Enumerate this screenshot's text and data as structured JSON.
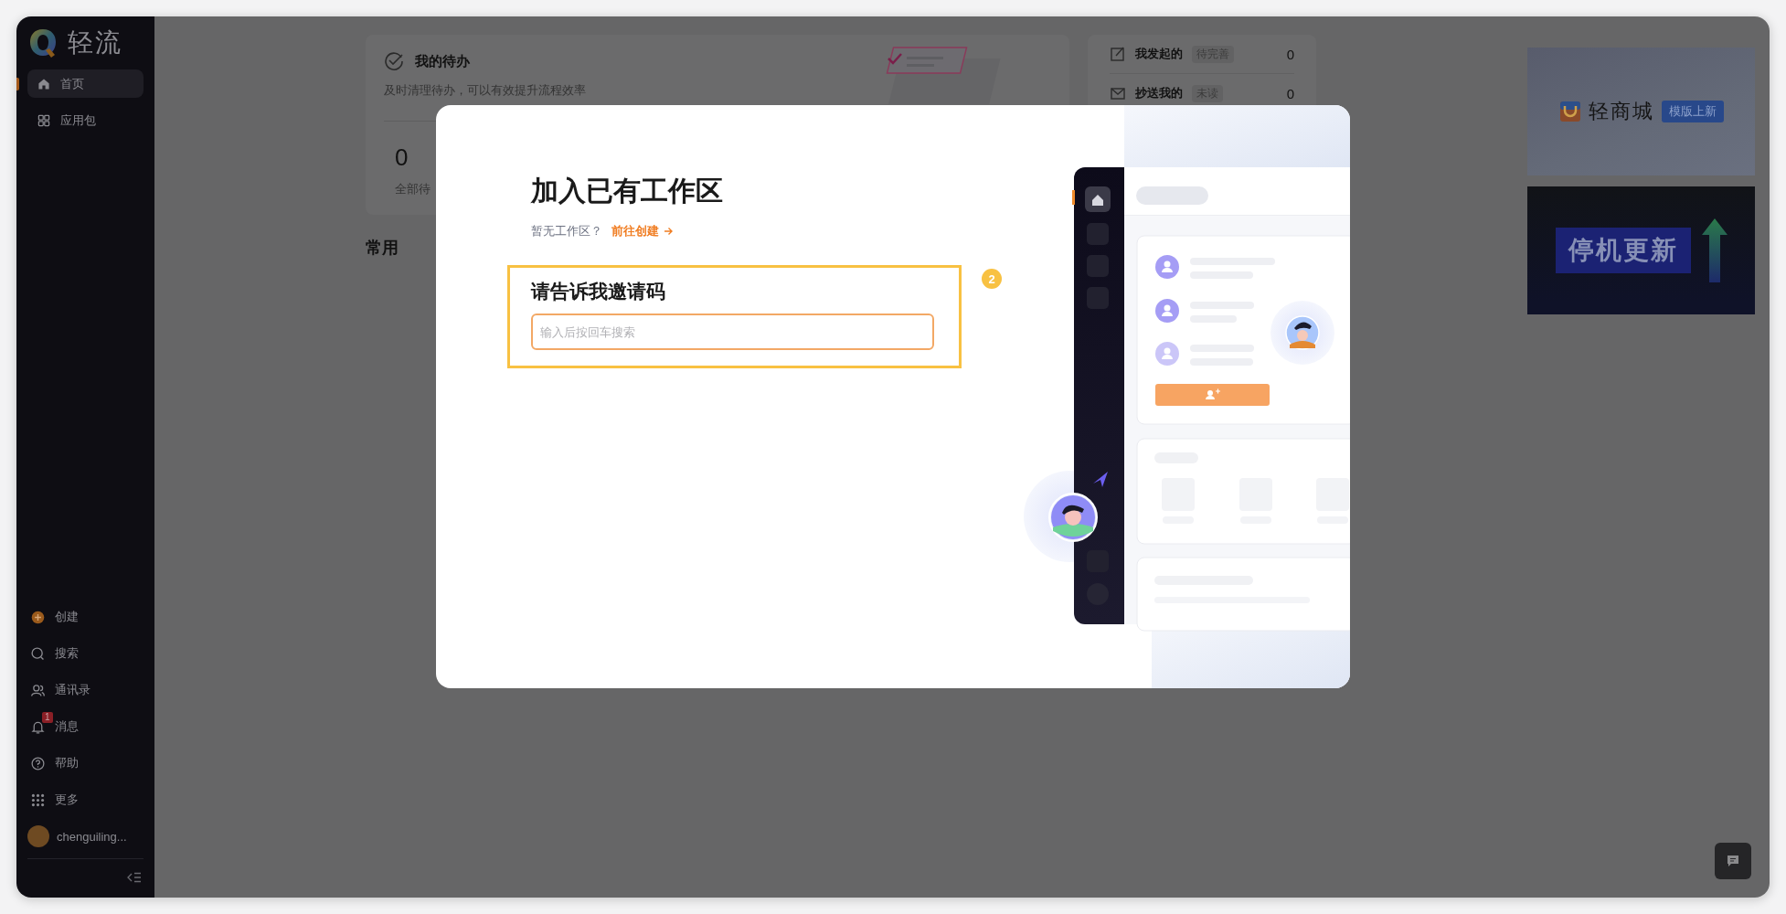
{
  "sidebar": {
    "logo_text": "轻流",
    "nav": [
      {
        "label": "首页",
        "selected": true
      },
      {
        "label": "应用包",
        "selected": false
      }
    ],
    "tools": [
      {
        "label": "创建"
      },
      {
        "label": "搜索"
      },
      {
        "label": "通讯录"
      },
      {
        "label": "消息",
        "badge": "1"
      },
      {
        "label": "帮助"
      },
      {
        "label": "更多"
      }
    ],
    "user": {
      "name": "chenguiling..."
    }
  },
  "todo_card": {
    "title": "我的待办",
    "subtitle": "及时清理待办，可以有效提升流程效率",
    "count": "0",
    "count_label": "全部待"
  },
  "section_title": "常用",
  "summary_rows": [
    {
      "label": "我发起的",
      "tag": "待完善",
      "count": "0"
    },
    {
      "label": "抄送我的",
      "tag": "未读",
      "count": "0"
    }
  ],
  "banners": [
    {
      "kind": "shop",
      "title": "轻商城",
      "tag": "模版上新"
    },
    {
      "kind": "maintenance",
      "title": "停机更新"
    }
  ],
  "dialog": {
    "title": "加入已有工作区",
    "hint": "暂无工作区？",
    "link": "前往创建",
    "prompt": "请告诉我邀请码",
    "placeholder": "输入后按回车搜索",
    "step": "2"
  }
}
